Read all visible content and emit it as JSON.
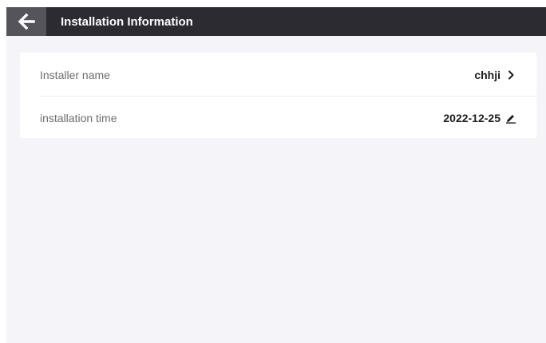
{
  "header": {
    "title": "Installation Information",
    "back_icon": "arrow-left-icon"
  },
  "fields": [
    {
      "label": "Installer name",
      "value": "chhji",
      "icon": "chevron-right-icon"
    },
    {
      "label": "installation time",
      "value": "2022-12-25",
      "icon": "pencil-icon"
    }
  ],
  "colors": {
    "header_bg": "#2b2b31",
    "back_button_bg": "#54545a",
    "page_bg": "#f5f5f9",
    "card_bg": "#ffffff",
    "label_text": "#6d6d72",
    "value_text": "#1c1c1e"
  }
}
